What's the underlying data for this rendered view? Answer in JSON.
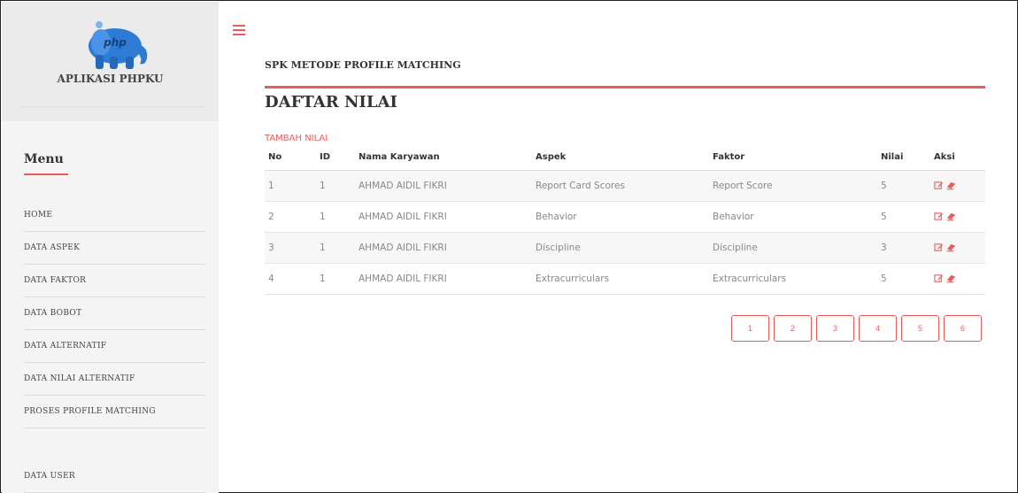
{
  "app": {
    "name": "APLIKASI PHPKU",
    "logo_icon": "php-elephant-icon",
    "logo_text": "php"
  },
  "sidebar": {
    "menu_title": "Menu",
    "items": [
      {
        "label": "HOME"
      },
      {
        "label": "DATA ASPEK"
      },
      {
        "label": "DATA FAKTOR"
      },
      {
        "label": "DATA BOBOT"
      },
      {
        "label": "DATA ALTERNATIF"
      },
      {
        "label": "DATA NILAI ALTERNATIF"
      },
      {
        "label": "PROSES PROFILE MATCHING"
      },
      {
        "label": "DATA USER"
      }
    ]
  },
  "header": {
    "menu_toggle_icon": "hamburger-icon",
    "title": "SPK METODE PROFILE MATCHING"
  },
  "main": {
    "page_title": "DAFTAR NILAI",
    "add_link": "TAMBAH NILAI",
    "table": {
      "columns": [
        "No",
        "ID",
        "Nama Karyawan",
        "Aspek",
        "Faktor",
        "Nilai",
        "Aksi"
      ],
      "rows": [
        {
          "no": "1",
          "id": "1",
          "nama": "AHMAD AIDIL FIKRI",
          "aspek": "Report Card Scores",
          "faktor": "Report Score",
          "nilai": "5"
        },
        {
          "no": "2",
          "id": "1",
          "nama": "AHMAD AIDIL FIKRI",
          "aspek": "Behavior",
          "faktor": "Behavior",
          "nilai": "5"
        },
        {
          "no": "3",
          "id": "1",
          "nama": "AHMAD AIDIL FIKRI",
          "aspek": "Discipline",
          "faktor": "Discipline",
          "nilai": "3"
        },
        {
          "no": "4",
          "id": "1",
          "nama": "AHMAD AIDIL FIKRI",
          "aspek": "Extracurriculars",
          "faktor": "Extracurriculars",
          "nilai": "5"
        }
      ],
      "action_icons": [
        "edit-icon",
        "eraser-icon"
      ]
    },
    "pagination": [
      "1",
      "2",
      "3",
      "4",
      "5",
      "6"
    ]
  },
  "colors": {
    "accent": "#e85c5c",
    "sidebar_bg": "#f4f4f5",
    "brand_bg": "#ebebec",
    "logo_blue": "#2e7bd6"
  }
}
